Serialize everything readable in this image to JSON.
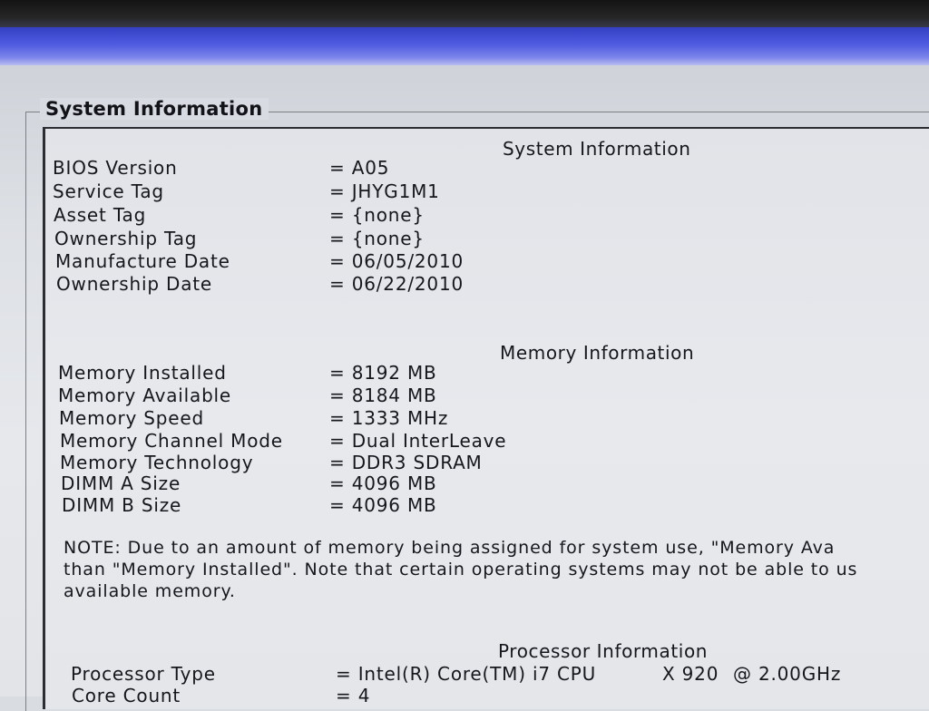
{
  "window": {
    "legend": "System Information"
  },
  "system": {
    "heading": "System Information",
    "rows": [
      {
        "label": "BIOS Version",
        "value": "= A05"
      },
      {
        "label": "Service Tag",
        "value": "= JHYG1M1"
      },
      {
        "label": "Asset Tag",
        "value": "= {none}"
      },
      {
        "label": "Ownership Tag",
        "value": "= {none}"
      },
      {
        "label": "Manufacture Date",
        "value": "= 06/05/2010"
      },
      {
        "label": "Ownership Date",
        "value": "= 06/22/2010"
      }
    ]
  },
  "memory": {
    "heading": "Memory Information",
    "rows": [
      {
        "label": "Memory Installed",
        "value": "= 8192 MB"
      },
      {
        "label": "Memory Available",
        "value": "= 8184 MB"
      },
      {
        "label": "Memory Speed",
        "value": "= 1333 MHz"
      },
      {
        "label": "Memory Channel Mode",
        "value": "= Dual InterLeave"
      },
      {
        "label": "Memory Technology",
        "value": "= DDR3 SDRAM"
      },
      {
        "label": "DIMM A Size",
        "value": "= 4096 MB"
      },
      {
        "label": "DIMM B Size",
        "value": "= 4096 MB"
      }
    ],
    "note_lines": [
      "NOTE: Due to an amount of memory being assigned for system use, \"Memory Ava",
      "than \"Memory Installed\". Note that certain operating systems may not be able to us",
      "available memory."
    ]
  },
  "processor": {
    "heading": "Processor Information",
    "rows": [
      {
        "label": "Processor Type",
        "value": "= Intel(R) Core(TM) i7 CPU",
        "model": "X 920",
        "speed": "@ 2.00GHz"
      },
      {
        "label": "Core Count",
        "value": "= 4"
      }
    ]
  },
  "colors": {
    "title_bar": "#4f5be0",
    "screen_background": "#e4e6ea",
    "text": "#15171c"
  }
}
